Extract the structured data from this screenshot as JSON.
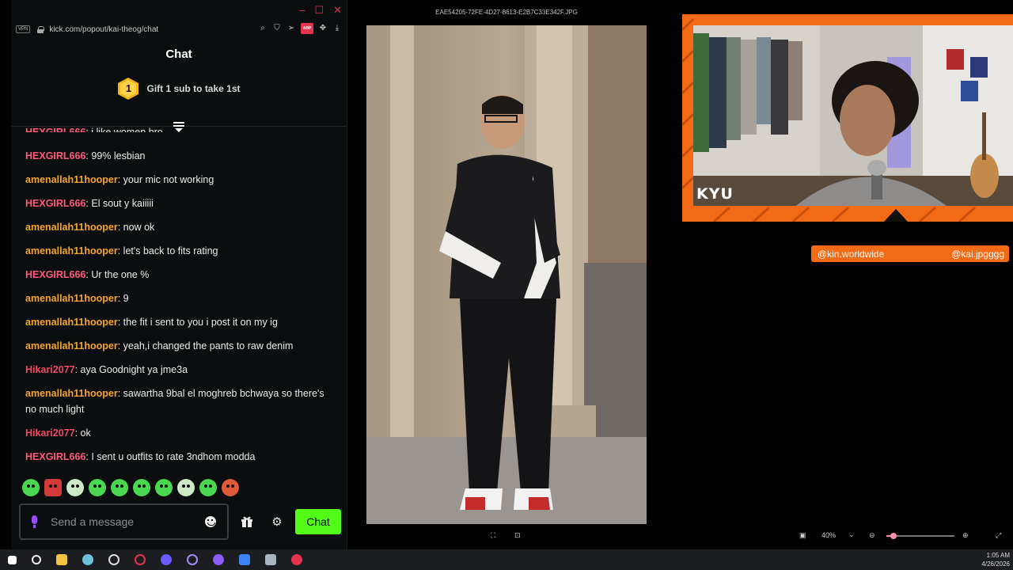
{
  "browser": {
    "vpn_label": "VPN",
    "url": "kick.com/popout/kai-theog/chat",
    "adblock_label": "ABP"
  },
  "chat": {
    "title": "Chat",
    "gift_badge_number": "1",
    "gift_text": "Gift 1 sub to take 1st",
    "messages": [
      {
        "user": "HEXGIRL666",
        "text": "99% lesbian",
        "color": "pink"
      },
      {
        "user": "amenallah11hooper",
        "text": "your mic not working",
        "color": "orange"
      },
      {
        "user": "HEXGIRL666",
        "text": "El sout y kaiiiii",
        "color": "pink"
      },
      {
        "user": "amenallah11hooper",
        "text": "now ok",
        "color": "orange"
      },
      {
        "user": "amenallah11hooper",
        "text": "let's back to fits rating",
        "color": "orange"
      },
      {
        "user": "HEXGIRL666",
        "text": "Ur the one %",
        "color": "pink"
      },
      {
        "user": "amenallah11hooper",
        "text": "9",
        "color": "orange"
      },
      {
        "user": "amenallah11hooper",
        "text": "the fit i sent to you i post it on my ig",
        "color": "orange"
      },
      {
        "user": "amenallah11hooper",
        "text": "yeah,i changed the pants to raw denim",
        "color": "orange"
      },
      {
        "user": "Hikari2077",
        "text": "aya Goodnight ya jme3a",
        "color": "red"
      },
      {
        "user": "amenallah11hooper",
        "text": "sawartha 9bal el moghreb bchwaya so there's no much light",
        "color": "orange"
      },
      {
        "user": "Hikari2077",
        "text": "ok",
        "color": "red"
      },
      {
        "user": "HEXGIRL666",
        "text": "I sent u outfits to rate 3ndhom modda",
        "color": "pink"
      }
    ],
    "input_placeholder": "Send a message",
    "send_label": "Chat",
    "colors": {
      "accent": "#53fc18",
      "orange": "#f7a52a",
      "pink": "#ff5a7a",
      "red": "#f4486a"
    }
  },
  "viewer": {
    "filename": "EAE54205-72FE-4D27-8613-E2B7C33E342F.JPG",
    "zoom_percent": "40%"
  },
  "overlay": {
    "cam_label": "KYU",
    "social_left": "@kin.worldwide",
    "social_right": "@kai.jpgggg",
    "frame_color": "#f36a17"
  },
  "taskbar": {
    "time": "1:05 AM",
    "date": "4/26/2026"
  }
}
